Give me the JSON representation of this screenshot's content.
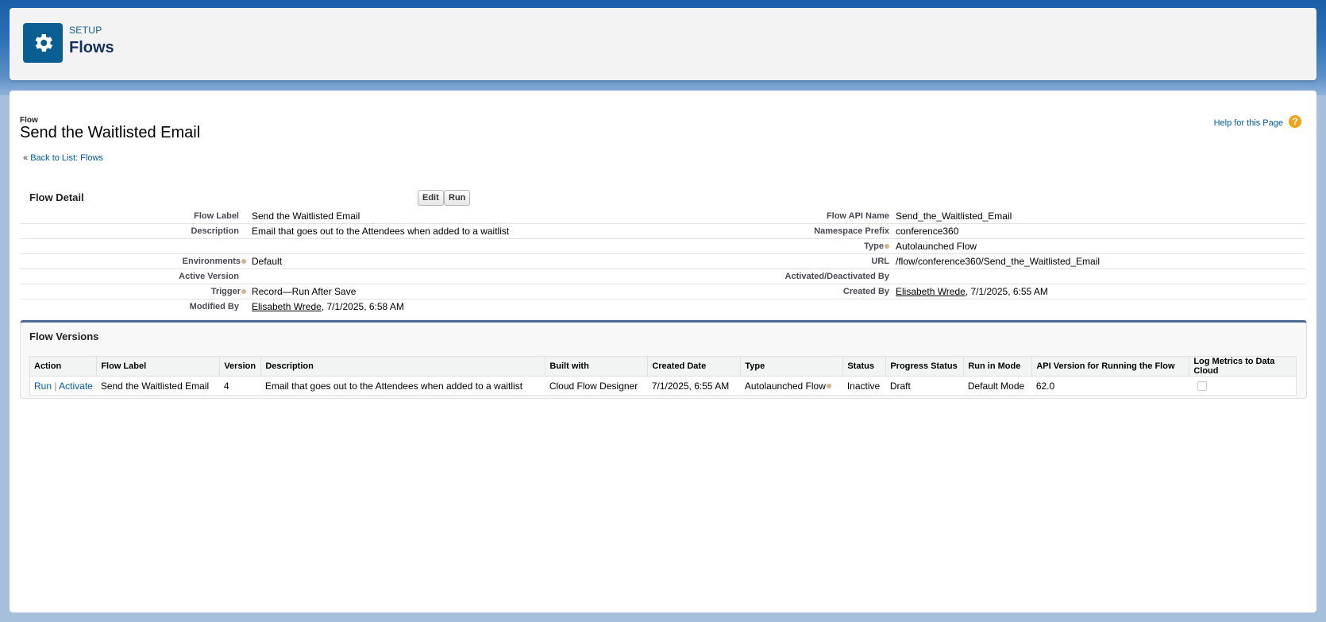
{
  "header": {
    "eyebrow": "SETUP",
    "title": "Flows",
    "icon": "gear-icon"
  },
  "page": {
    "eyebrow": "Flow",
    "title": "Send the Waitlisted Email",
    "help_label": "Help for this Page",
    "back_link_prefix": "« ",
    "back_link": "Back to List: Flows"
  },
  "detail": {
    "title": "Flow Detail",
    "edit_label": "Edit",
    "run_label": "Run",
    "left": [
      {
        "label": "Flow Label",
        "value": "Send the Waitlisted Email"
      },
      {
        "label": "Description",
        "value": "Email that goes out to the Attendees when added to a waitlist"
      },
      {
        "label": "",
        "value": ""
      },
      {
        "label": "Environments",
        "value": "Default"
      },
      {
        "label": "Active Version",
        "value": ""
      },
      {
        "label": "Trigger",
        "value": "Record—Run After Save"
      },
      {
        "label": "Modified By",
        "user": "Elisabeth Wrede",
        "value": ", 7/1/2025, 6:58 AM"
      }
    ],
    "right": [
      {
        "label": "Flow API Name",
        "value": "Send_the_Waitlisted_Email"
      },
      {
        "label": "Namespace Prefix",
        "value": "conference360"
      },
      {
        "label": "Type",
        "value": "Autolaunched Flow"
      },
      {
        "label": "URL",
        "value": "/flow/conference360/Send_the_Waitlisted_Email"
      },
      {
        "label": "Activated/Deactivated By",
        "value": ""
      },
      {
        "label": "Created By",
        "user": "Elisabeth Wrede",
        "value": ", 7/1/2025, 6:55 AM"
      }
    ]
  },
  "versions": {
    "title": "Flow Versions",
    "columns": [
      "Action",
      "Flow Label",
      "Version",
      "Description",
      "Built with",
      "Created Date",
      "Type",
      "Status",
      "Progress Status",
      "Run in Mode",
      "API Version for Running the Flow",
      "Log Metrics to Data Cloud"
    ],
    "rows": [
      {
        "action_run": "Run",
        "action_sep": " | ",
        "action_activate": "Activate",
        "flow_label": "Send the Waitlisted Email",
        "version": "4",
        "description": "Email that goes out to the Attendees when added to a waitlist",
        "built_with": "Cloud Flow Designer",
        "created_date": "7/1/2025, 6:55 AM",
        "type": "Autolaunched Flow",
        "status": "Inactive",
        "progress_status": "Draft",
        "run_in_mode": "Default Mode",
        "api_version": "62.0",
        "log_metrics": false
      }
    ]
  },
  "colors": {
    "accent": "#0b5e92",
    "link": "#015ba7",
    "help": "#f0a41e"
  }
}
